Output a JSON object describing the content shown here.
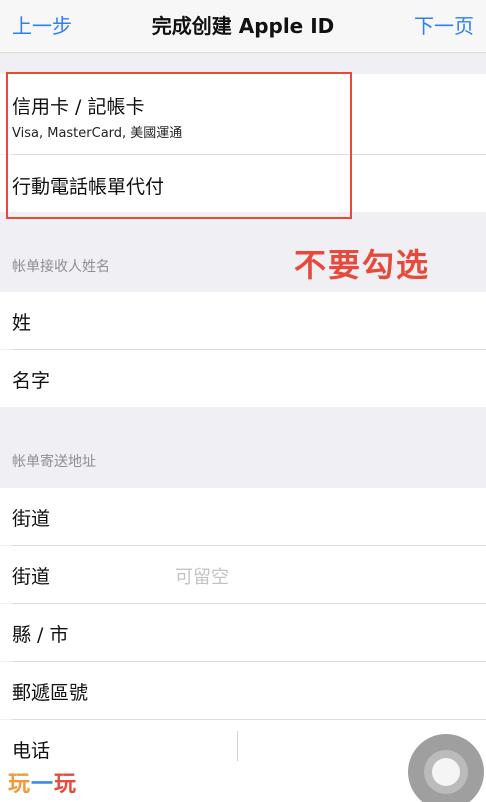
{
  "navbar": {
    "back_label": "上一步",
    "title": "完成创建 Apple ID",
    "next_label": "下一页"
  },
  "payment": {
    "card_label": "信用卡 / 記帳卡",
    "card_sub": "Visa, MasterCard, 美國運通",
    "mobile_label": "行動電話帳單代付"
  },
  "annotation_text": "不要勾选",
  "billing_name": {
    "header": "帐单接收人姓名",
    "last_name_label": "姓",
    "first_name_label": "名字"
  },
  "billing_address": {
    "header": "帐单寄送地址",
    "street1_label": "街道",
    "street2_label": "街道",
    "street2_placeholder": "可留空",
    "city_label": "縣 / 市",
    "postal_label": "郵遞區號",
    "phone_label": "电话"
  },
  "watermark": {
    "part1": "玩",
    "part2": "一",
    "part3": "玩"
  }
}
